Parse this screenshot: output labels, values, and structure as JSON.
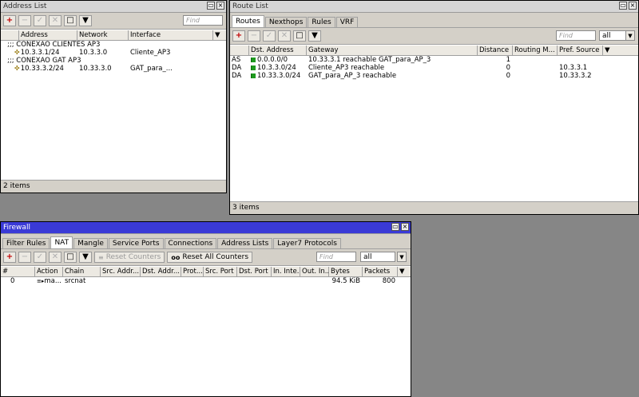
{
  "address_list": {
    "title": "Address List",
    "find_placeholder": "Find",
    "columns": [
      "Address",
      "Network",
      "Interface"
    ],
    "groups": [
      {
        "comment": ";;; CONEXAO  CLIENTES  AP3",
        "address": "10.3.3.1/24",
        "network": "10.3.3.0",
        "interface": "Cliente_AP3"
      },
      {
        "comment": ";;; CONEXAO  GAT  AP3",
        "address": "10.33.3.2/24",
        "network": "10.33.3.0",
        "interface": "GAT_para_..."
      }
    ],
    "status": "2 items"
  },
  "route_list": {
    "title": "Route List",
    "tabs": [
      "Routes",
      "Nexthops",
      "Rules",
      "VRF"
    ],
    "find_placeholder": "Find",
    "filter_value": "all",
    "columns": [
      "",
      "Dst. Address",
      "Gateway",
      "Distance",
      "Routing M...",
      "Pref. Source"
    ],
    "rows": [
      {
        "flags": "AS",
        "dst": "0.0.0.0/0",
        "gateway": "10.33.3.1 reachable GAT_para_AP_3",
        "distance": "1",
        "routing": "",
        "pref": ""
      },
      {
        "flags": "DA",
        "dst": "10.3.3.0/24",
        "gateway": "Cliente_AP3 reachable",
        "distance": "0",
        "routing": "",
        "pref": "10.3.3.1"
      },
      {
        "flags": "DA",
        "dst": "10.33.3.0/24",
        "gateway": "GAT_para_AP_3 reachable",
        "distance": "0",
        "routing": "",
        "pref": "10.33.3.2"
      }
    ],
    "status": "3 items"
  },
  "firewall": {
    "title": "Firewall",
    "tabs": [
      "Filter Rules",
      "NAT",
      "Mangle",
      "Service Ports",
      "Connections",
      "Address Lists",
      "Layer7 Protocols"
    ],
    "reset_counters": "Reset Counters",
    "reset_all_counters": "Reset All Counters",
    "oo_label": "oo",
    "find_placeholder": "Find",
    "filter_value": "all",
    "columns": [
      "#",
      "Action",
      "Chain",
      "Src. Addr...",
      "Dst. Addr...",
      "Prot...",
      "Src. Port",
      "Dst. Port",
      "In. Inte...",
      "Out. In...",
      "Bytes",
      "Packets"
    ],
    "rows": [
      {
        "num": "0",
        "action": "ma...",
        "chain": "srcnat",
        "bytes": "94.5 KiB",
        "packets": "800"
      }
    ]
  },
  "icons": {
    "add": "plus-icon",
    "remove": "minus-icon",
    "enable": "check-icon",
    "disable": "x-icon",
    "comment": "note-icon",
    "filter": "funnel-icon"
  },
  "colors": {
    "background": "#868686",
    "title_active": "#3a3ad6",
    "add_red": "#c00000",
    "flag_green": "#1e9a1e"
  }
}
